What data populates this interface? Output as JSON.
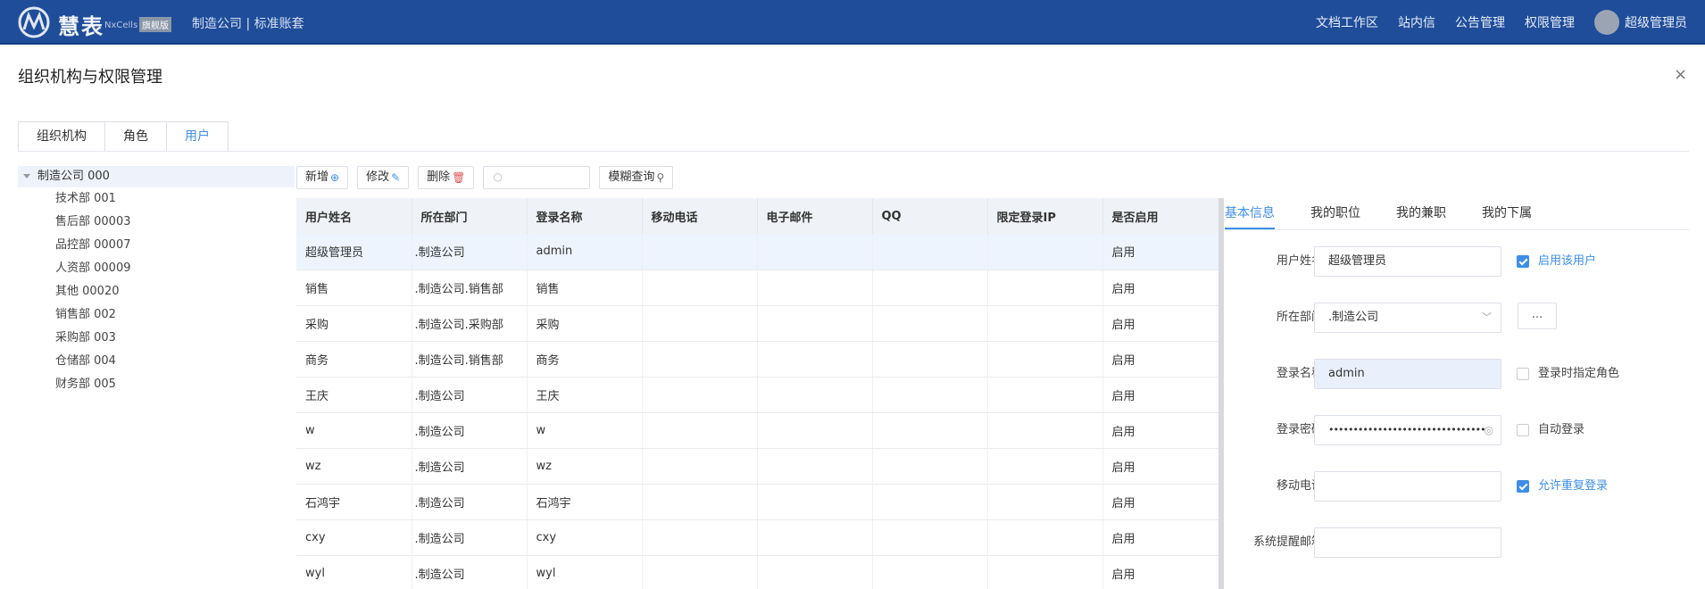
{
  "header": {
    "brand": "慧表",
    "brand_sub": "NxCells",
    "brand_badge": "旗舰版",
    "company": "制造公司 | 标准账套",
    "nav": [
      "文档工作区",
      "站内信",
      "公告管理",
      "权限管理"
    ],
    "user": "超级管理员"
  },
  "page": {
    "title": "组织机构与权限管理",
    "close": "×"
  },
  "tabs": [
    "组织机构",
    "角色",
    "用户"
  ],
  "active_tab": "用户",
  "tree": {
    "root": "制造公司 000",
    "items": [
      "技术部 001",
      "售后部 00003",
      "品控部 00007",
      "人资部 00009",
      "其他 00020",
      "销售部 002",
      "采购部 003",
      "仓储部 004",
      "财务部 005"
    ]
  },
  "toolbar": {
    "add": "新增",
    "edit": "修改",
    "delete": "删除",
    "search_placeholder": "",
    "fuzzy": "模糊查询"
  },
  "table": {
    "columns": [
      "用户姓名",
      "所在部门",
      "登录名称",
      "移动电话",
      "电子邮件",
      "QQ",
      "限定登录IP",
      "是否启用"
    ],
    "rows": [
      [
        "超级管理员",
        ".制造公司",
        "admin",
        "",
        "",
        "",
        "",
        "启用"
      ],
      [
        "销售",
        ".制造公司.销售部",
        "销售",
        "",
        "",
        "",
        "",
        "启用"
      ],
      [
        "采购",
        ".制造公司.采购部",
        "采购",
        "",
        "",
        "",
        "",
        "启用"
      ],
      [
        "商务",
        ".制造公司.销售部",
        "商务",
        "",
        "",
        "",
        "",
        "启用"
      ],
      [
        "王庆",
        ".制造公司",
        "王庆",
        "",
        "",
        "",
        "",
        "启用"
      ],
      [
        "w",
        ".制造公司",
        "w",
        "",
        "",
        "",
        "",
        "启用"
      ],
      [
        "wz",
        ".制造公司",
        "wz",
        "",
        "",
        "",
        "",
        "启用"
      ],
      [
        "石鸿宇",
        ".制造公司",
        "石鸿宇",
        "",
        "",
        "",
        "",
        "启用"
      ],
      [
        "cxy",
        ".制造公司",
        "cxy",
        "",
        "",
        "",
        "",
        "启用"
      ],
      [
        "wyl",
        ".制造公司",
        "wyl",
        "",
        "",
        "",
        "",
        "启用"
      ]
    ]
  },
  "detail": {
    "tabs": [
      "基本信息",
      "我的职位",
      "我的兼职",
      "我的下属"
    ],
    "fields": {
      "name_label": "用户姓名",
      "name_value": "超级管理员",
      "dept_label": "所在部门",
      "dept_value": ".制造公司",
      "dept_more": "...",
      "login_label": "登录名称",
      "login_value": "admin",
      "pwd_label": "登录密码",
      "pwd_value": "••••••••••••••••••••••••••••••••",
      "phone_label": "移动电话",
      "phone_value": "",
      "mail_label": "系统提醒邮箱",
      "mail_value": ""
    },
    "checks": {
      "enable": "启用该用户",
      "assign_role": "登录时指定角色",
      "auto_login": "自动登录",
      "allow_repeat": "允许重复登录"
    }
  },
  "colors": {
    "topbar": "#1f4d9a",
    "accent": "#3c8ee8"
  }
}
